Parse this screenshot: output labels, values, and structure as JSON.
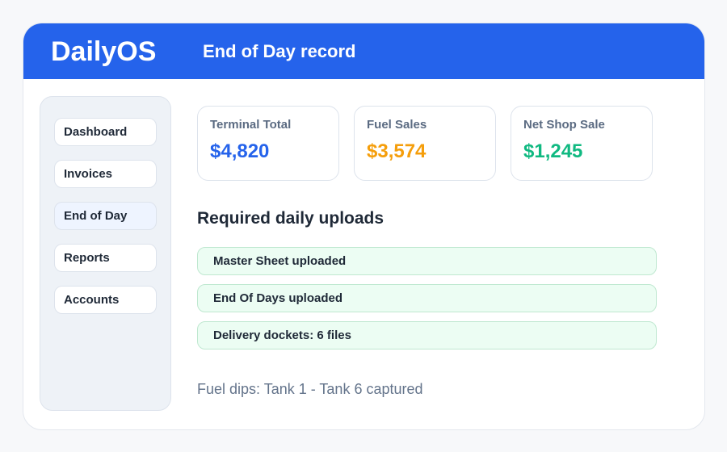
{
  "header": {
    "brand": "DailyOS",
    "title": "End of Day record",
    "color": "#2563eb"
  },
  "sidebar": {
    "items": [
      {
        "label": "Dashboard"
      },
      {
        "label": "Invoices"
      },
      {
        "label": "End of Day",
        "active": true
      },
      {
        "label": "Reports"
      },
      {
        "label": "Accounts"
      }
    ]
  },
  "cards": [
    {
      "label": "Terminal Total",
      "value": "$4,820",
      "color": "#2563eb"
    },
    {
      "label": "Fuel Sales",
      "value": "$3,574",
      "color": "#f59e0b"
    },
    {
      "label": "Net Shop Sale",
      "value": "$1,245",
      "color": "#10b981"
    }
  ],
  "uploads": {
    "title": "Required daily uploads",
    "items": [
      {
        "label": "Master Sheet uploaded"
      },
      {
        "label": "End Of Days uploaded"
      },
      {
        "label": "Delivery dockets: 6 files"
      }
    ]
  },
  "fuel_dips": "Fuel dips: Tank 1 - Tank 6 captured"
}
